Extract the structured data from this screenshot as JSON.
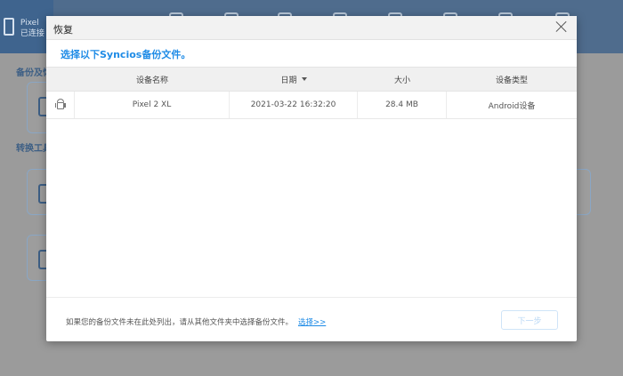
{
  "background": {
    "device_name": "Pixel",
    "device_status": "已连接",
    "section_backup": "备份及恢",
    "section_convert": "转换工具"
  },
  "dialog": {
    "title": "恢复",
    "instruction": "选择以下Syncios备份文件。",
    "table": {
      "headers": {
        "name": "设备名称",
        "date": "日期",
        "size": "大小",
        "type": "设备类型"
      },
      "rows": [
        {
          "icon": "android-icon",
          "name": "Pixel 2 XL",
          "date": "2021-03-22 16:32:20",
          "size": "28.4 MB",
          "type": "Android设备"
        }
      ]
    },
    "footer_text": "如果您的备份文件未在此处列出，请从其他文件夹中选择备份文件。",
    "footer_link": "选择>>",
    "next_button": "下一步"
  },
  "colors": {
    "accent": "#1e8be6",
    "header_bg": "#f2f2f2"
  }
}
